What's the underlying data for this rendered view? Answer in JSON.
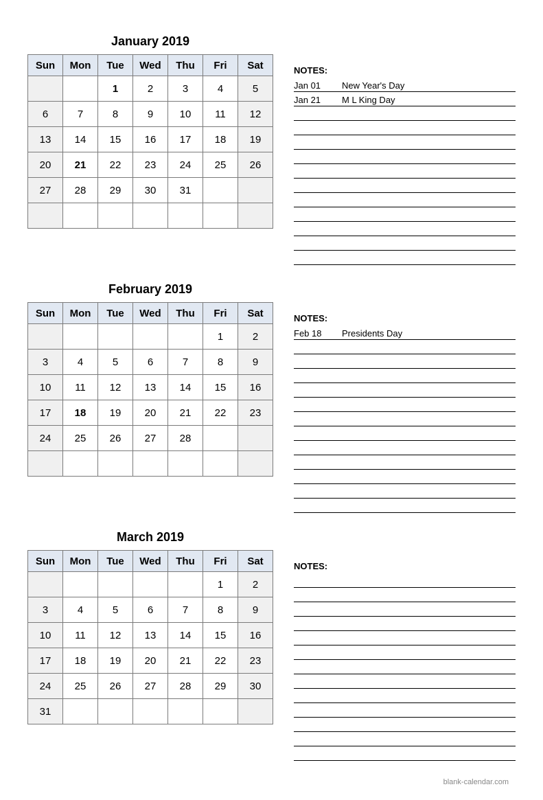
{
  "day_headers": [
    "Sun",
    "Mon",
    "Tue",
    "Wed",
    "Thu",
    "Fri",
    "Sat"
  ],
  "notes_label": "NOTES:",
  "note_lines": 13,
  "footer": "blank-calendar.com",
  "months": [
    {
      "title": "January 2019",
      "holidays_idx": [
        1,
        21
      ],
      "weeks": [
        [
          "",
          "",
          "1",
          "2",
          "3",
          "4",
          "5"
        ],
        [
          "6",
          "7",
          "8",
          "9",
          "10",
          "11",
          "12"
        ],
        [
          "13",
          "14",
          "15",
          "16",
          "17",
          "18",
          "19"
        ],
        [
          "20",
          "21",
          "22",
          "23",
          "24",
          "25",
          "26"
        ],
        [
          "27",
          "28",
          "29",
          "30",
          "31",
          "",
          ""
        ],
        [
          "",
          "",
          "",
          "",
          "",
          "",
          ""
        ]
      ],
      "notes": [
        {
          "date": "Jan 01",
          "text": "New Year's Day"
        },
        {
          "date": "Jan 21",
          "text": "M L King Day"
        }
      ]
    },
    {
      "title": "February 2019",
      "holidays_idx": [
        18
      ],
      "weeks": [
        [
          "",
          "",
          "",
          "",
          "",
          "1",
          "2"
        ],
        [
          "3",
          "4",
          "5",
          "6",
          "7",
          "8",
          "9"
        ],
        [
          "10",
          "11",
          "12",
          "13",
          "14",
          "15",
          "16"
        ],
        [
          "17",
          "18",
          "19",
          "20",
          "21",
          "22",
          "23"
        ],
        [
          "24",
          "25",
          "26",
          "27",
          "28",
          "",
          ""
        ],
        [
          "",
          "",
          "",
          "",
          "",
          "",
          ""
        ]
      ],
      "notes": [
        {
          "date": "Feb 18",
          "text": "Presidents Day"
        }
      ]
    },
    {
      "title": "March 2019",
      "holidays_idx": [],
      "weeks": [
        [
          "",
          "",
          "",
          "",
          "",
          "1",
          "2"
        ],
        [
          "3",
          "4",
          "5",
          "6",
          "7",
          "8",
          "9"
        ],
        [
          "10",
          "11",
          "12",
          "13",
          "14",
          "15",
          "16"
        ],
        [
          "17",
          "18",
          "19",
          "20",
          "21",
          "22",
          "23"
        ],
        [
          "24",
          "25",
          "26",
          "27",
          "28",
          "29",
          "30"
        ],
        [
          "31",
          "",
          "",
          "",
          "",
          "",
          ""
        ]
      ],
      "notes": []
    }
  ]
}
